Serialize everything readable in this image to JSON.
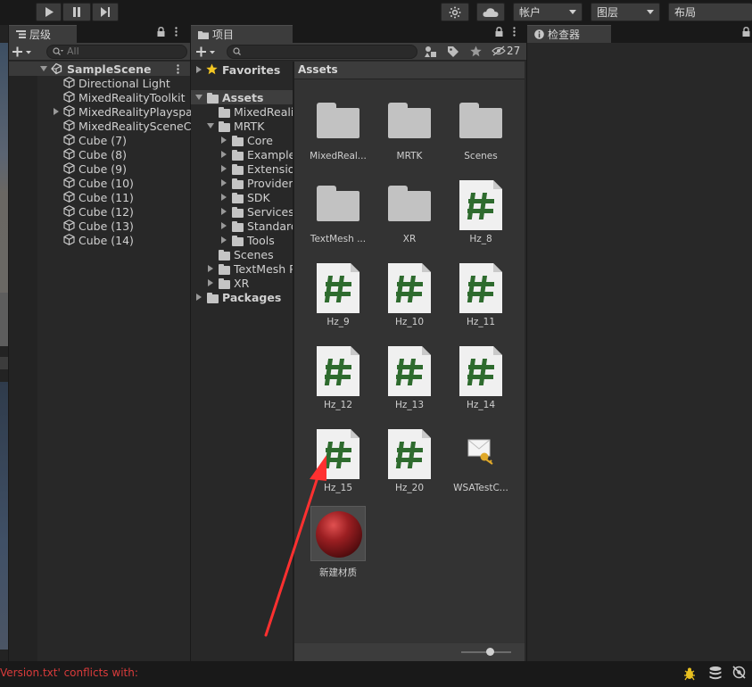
{
  "toolbar": {
    "account_label": "帐户",
    "layers_label": "图层",
    "layout_label": "布局"
  },
  "hierarchy": {
    "tab_label": "层级",
    "search_placeholder": "All",
    "scene_name": "SampleScene",
    "items": [
      {
        "label": "Directional Light",
        "expandable": false
      },
      {
        "label": "MixedRealityToolkit",
        "expandable": false
      },
      {
        "label": "MixedRealityPlayspace",
        "expandable": true
      },
      {
        "label": "MixedRealitySceneContent",
        "expandable": false
      },
      {
        "label": "Cube (7)",
        "expandable": false
      },
      {
        "label": "Cube (8)",
        "expandable": false
      },
      {
        "label": "Cube (9)",
        "expandable": false
      },
      {
        "label": "Cube (10)",
        "expandable": false
      },
      {
        "label": "Cube (11)",
        "expandable": false
      },
      {
        "label": "Cube (12)",
        "expandable": false
      },
      {
        "label": "Cube (13)",
        "expandable": false
      },
      {
        "label": "Cube (14)",
        "expandable": false
      }
    ]
  },
  "project": {
    "tab_label": "项目",
    "hidden_count": "27",
    "favorites_label": "Favorites",
    "breadcrumb": "Assets",
    "tree": [
      {
        "label": "Assets",
        "depth": 0,
        "arrow": "down",
        "bold": true,
        "selected": true
      },
      {
        "label": "MixedRealityToolkit.Generated",
        "depth": 1,
        "arrow": "none"
      },
      {
        "label": "MRTK",
        "depth": 1,
        "arrow": "down"
      },
      {
        "label": "Core",
        "depth": 2,
        "arrow": "right"
      },
      {
        "label": "Examples",
        "depth": 2,
        "arrow": "right"
      },
      {
        "label": "Extensions",
        "depth": 2,
        "arrow": "right"
      },
      {
        "label": "Providers",
        "depth": 2,
        "arrow": "right"
      },
      {
        "label": "SDK",
        "depth": 2,
        "arrow": "right"
      },
      {
        "label": "Services",
        "depth": 2,
        "arrow": "right"
      },
      {
        "label": "StandardAssets",
        "depth": 2,
        "arrow": "right"
      },
      {
        "label": "Tools",
        "depth": 2,
        "arrow": "right"
      },
      {
        "label": "Scenes",
        "depth": 1,
        "arrow": "none"
      },
      {
        "label": "TextMesh Pro",
        "depth": 1,
        "arrow": "right"
      },
      {
        "label": "XR",
        "depth": 1,
        "arrow": "right"
      },
      {
        "label": "Packages",
        "depth": 0,
        "arrow": "right",
        "bold": true
      }
    ],
    "assets": [
      {
        "label": "MixedReal...",
        "kind": "folder"
      },
      {
        "label": "MRTK",
        "kind": "folder"
      },
      {
        "label": "Scenes",
        "kind": "folder"
      },
      {
        "label": "TextMesh ...",
        "kind": "folder"
      },
      {
        "label": "XR",
        "kind": "folder"
      },
      {
        "label": "Hz_8",
        "kind": "script"
      },
      {
        "label": "Hz_9",
        "kind": "script"
      },
      {
        "label": "Hz_10",
        "kind": "script"
      },
      {
        "label": "Hz_11",
        "kind": "script"
      },
      {
        "label": "Hz_12",
        "kind": "script"
      },
      {
        "label": "Hz_13",
        "kind": "script"
      },
      {
        "label": "Hz_14",
        "kind": "script"
      },
      {
        "label": "Hz_15",
        "kind": "script"
      },
      {
        "label": "Hz_20",
        "kind": "script"
      },
      {
        "label": "WSATestC...",
        "kind": "cert"
      },
      {
        "label": "新建材质",
        "kind": "material"
      }
    ]
  },
  "inspector": {
    "tab_label": "检查器"
  },
  "status": {
    "message": "Version.txt' conflicts with:",
    "message_color": "#d93b3b"
  },
  "colors": {
    "script_hash": "#2e6b2e",
    "annotation_arrow": "#ff3030"
  }
}
